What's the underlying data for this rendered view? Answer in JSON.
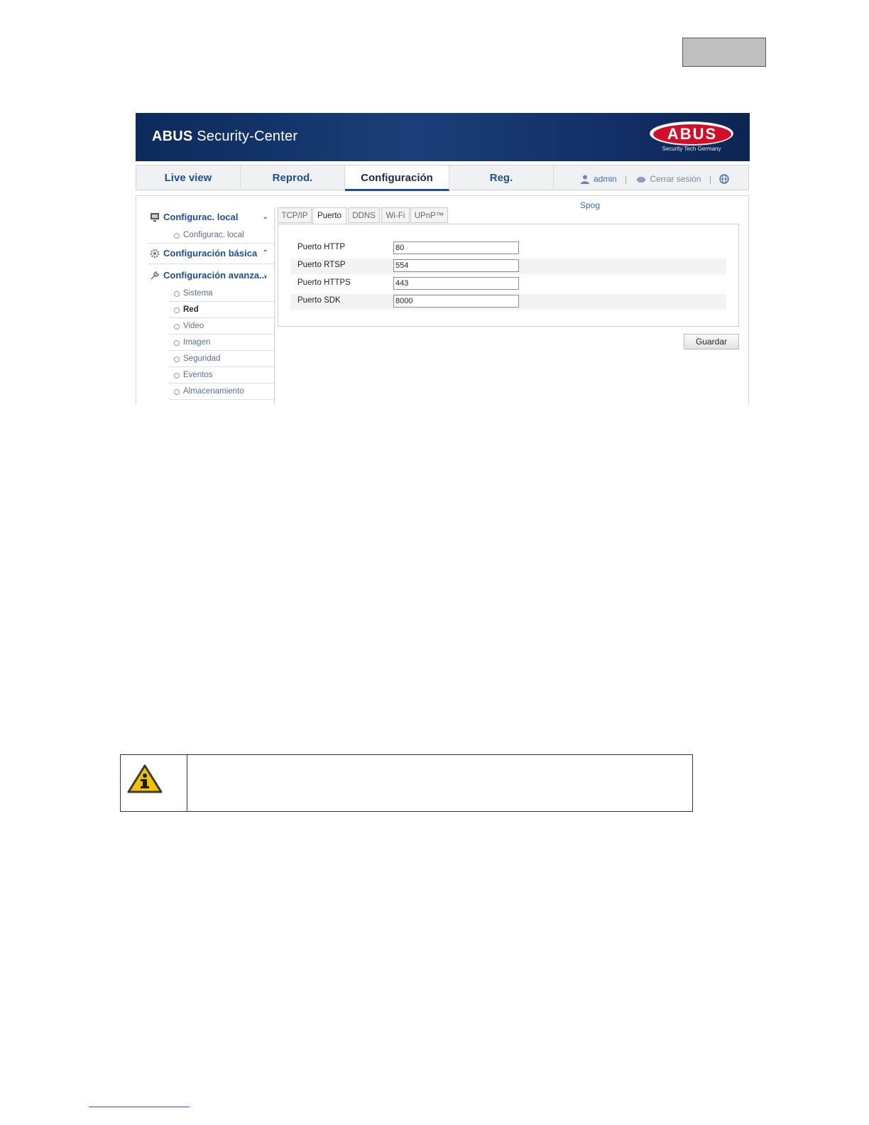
{
  "app": {
    "brand": "ABUS",
    "title": "Security-Center",
    "logo_text": "ABUS",
    "logo_tagline": "Security Tech Germany"
  },
  "nav": {
    "tabs": [
      {
        "label": "Live view"
      },
      {
        "label": "Reprod."
      },
      {
        "label": "Configuración"
      },
      {
        "label": "Reg."
      }
    ],
    "user": "admin",
    "logout": "Cerrar sesión",
    "language": "Spog"
  },
  "sidebar": {
    "local": {
      "label": "Configurac. local",
      "chevron": "⌄",
      "sub": "Configurac. local"
    },
    "basic": {
      "label": "Configuración básica",
      "chevron": "⌃"
    },
    "advanced": {
      "label": "Configuración avanza...",
      "chevron": "⌄",
      "items": [
        {
          "label": "Sistema"
        },
        {
          "label": "Red"
        },
        {
          "label": "Video"
        },
        {
          "label": "Imagen"
        },
        {
          "label": "Seguridad"
        },
        {
          "label": "Eventos"
        },
        {
          "label": "Almacenamiento"
        }
      ]
    }
  },
  "subtabs": [
    {
      "label": "TCP/IP"
    },
    {
      "label": "Puerto"
    },
    {
      "label": "DDNS"
    },
    {
      "label": "Wi-Fi"
    },
    {
      "label": "UPnP™"
    }
  ],
  "ports": {
    "http": {
      "label": "Puerto HTTP",
      "value": "80"
    },
    "rtsp": {
      "label": "Puerto RTSP",
      "value": "554"
    },
    "https": {
      "label": "Puerto HTTPS",
      "value": "443"
    },
    "sdk": {
      "label": "Puerto SDK",
      "value": "8000"
    }
  },
  "save_label": "Guardar",
  "colors": {
    "banner": "#13306a",
    "accent": "#1d4f8f",
    "logo_red": "#d0102a"
  }
}
